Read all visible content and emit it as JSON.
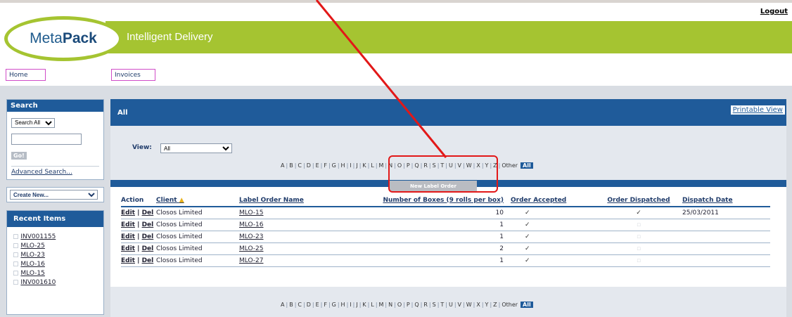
{
  "header": {
    "logout": "Logout",
    "logo_left": "Meta",
    "logo_right": "Pack",
    "tagline": "Intelligent Delivery"
  },
  "nav": {
    "tabs": [
      {
        "label": "Home"
      },
      {
        "label": "Invoices"
      }
    ]
  },
  "sidebar": {
    "search": {
      "title": "Search",
      "scope_selected": "Search All",
      "go_label": "Go!",
      "advanced_link": "Advanced Search..."
    },
    "create_new": "Create New...",
    "recent": {
      "title": "Recent Items",
      "items": [
        "INV001155",
        "MLO-25",
        "MLO-23",
        "MLO-16",
        "MLO-15",
        "INV001610"
      ]
    }
  },
  "main": {
    "title": "All",
    "printable_view": "Printable View",
    "view_label": "View:",
    "view_selected": "All",
    "alphabet": [
      "A",
      "B",
      "C",
      "D",
      "E",
      "F",
      "G",
      "H",
      "I",
      "J",
      "K",
      "L",
      "M",
      "N",
      "O",
      "P",
      "Q",
      "R",
      "S",
      "T",
      "U",
      "V",
      "W",
      "X",
      "Y",
      "Z"
    ],
    "alphabet_other": "Other",
    "alphabet_all": "All",
    "new_label_order": "New Label Order",
    "table": {
      "headers": {
        "action": "Action",
        "client": "Client",
        "name": "Label Order Name",
        "boxes": "Number of Boxes (9 rolls per box)",
        "accepted": "Order Accepted",
        "dispatched": "Order Dispatched",
        "date": "Dispatch Date"
      },
      "edit_label": "Edit",
      "del_label": "Del",
      "sep": "|",
      "rows": [
        {
          "client": "Closos Limited",
          "name": "MLO-15",
          "boxes": "10",
          "accepted": "✓",
          "dispatched": "✓",
          "date": "25/03/2011"
        },
        {
          "client": "Closos Limited",
          "name": "MLO-16",
          "boxes": "1",
          "accepted": "✓",
          "dispatched": "",
          "date": ""
        },
        {
          "client": "Closos Limited",
          "name": "MLO-23",
          "boxes": "1",
          "accepted": "✓",
          "dispatched": "",
          "date": ""
        },
        {
          "client": "Closos Limited",
          "name": "MLO-25",
          "boxes": "2",
          "accepted": "✓",
          "dispatched": "",
          "date": ""
        },
        {
          "client": "Closos Limited",
          "name": "MLO-27",
          "boxes": "1",
          "accepted": "✓",
          "dispatched": "",
          "date": ""
        }
      ]
    }
  },
  "colors": {
    "brand_green": "#a5c431",
    "brand_blue": "#1f5b9a",
    "annotation_red": "#e21818"
  }
}
